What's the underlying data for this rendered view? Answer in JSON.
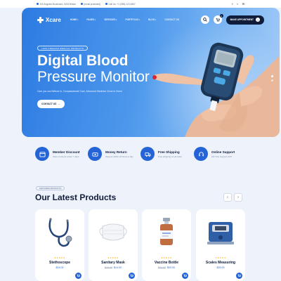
{
  "topbar": {
    "address": "100 Angeles Boulevard, 5204 Bristol",
    "email": "[email protected]",
    "phone": "Call Us: +1 (555) 123 4567",
    "social": [
      "f",
      "t",
      "✉"
    ]
  },
  "nav": {
    "logo": "Xcare",
    "menu": [
      "HOME",
      "PAGES",
      "SERVICES",
      "PORTFOLIO",
      "BLOG",
      "CONTACT US"
    ],
    "cart_count": "0",
    "appointment_label": "MAKE APPOINTMENT"
  },
  "hero": {
    "tag": "100% PREMIUM MEDICAL PRODUCTS",
    "title_line1": "Digital Blood",
    "title_line2": "Pressure Monitor",
    "subtitle": "Care you can Believe In, Compassionate Care, Advanced Medicine Close to Home",
    "cta": "CONTACT US"
  },
  "features": [
    {
      "title": "Member Discount",
      "subtitle": "Save products under 7 days",
      "icon": "calendar-icon"
    },
    {
      "title": "Money Return",
      "subtitle": "Support within 24 hours a day",
      "icon": "money-icon"
    },
    {
      "title": "Free Shipping",
      "subtitle": "Free shipping on all order",
      "icon": "truck-icon"
    },
    {
      "title": "Online Support",
      "subtitle": "24/7 live Support 24/7",
      "icon": "support-icon"
    }
  ],
  "section": {
    "tag": "FEATURED PRODUCTS",
    "title": "Our Latest Products"
  },
  "products": [
    {
      "name": "Stethoscope",
      "old_price": "",
      "price": "$14.00",
      "rating": 5
    },
    {
      "name": "Sanitary Mask",
      "old_price": "$16.00",
      "price": "$14.00",
      "rating": 5
    },
    {
      "name": "Vaccine Bottle",
      "old_price": "$24.00",
      "price": "$20.00",
      "rating": 5
    },
    {
      "name": "Scales Measuring",
      "old_price": "",
      "price": "$25.00",
      "rating": 5
    }
  ],
  "colors": {
    "primary": "#2464d6",
    "dark": "#0f1d3a",
    "star": "#f5b100"
  }
}
